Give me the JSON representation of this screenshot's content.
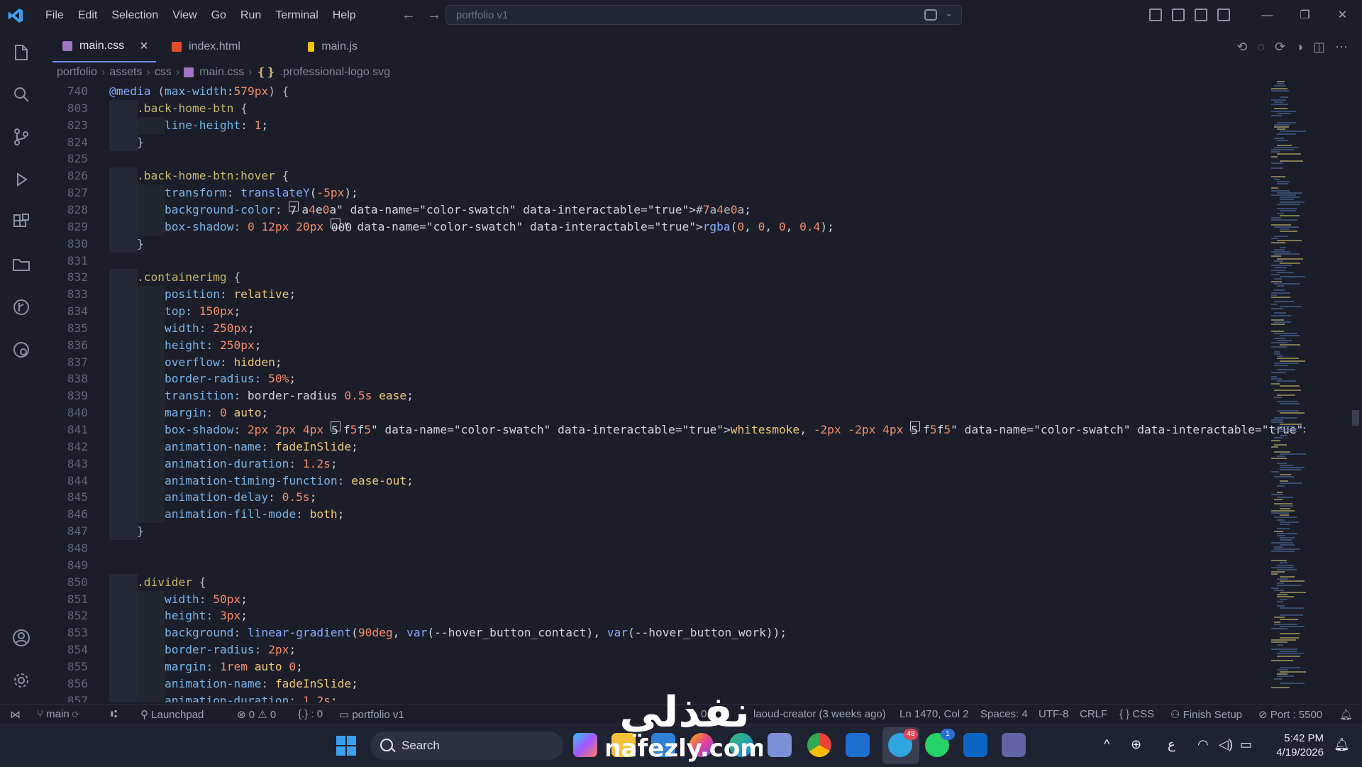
{
  "menu": [
    "File",
    "Edit",
    "Selection",
    "View",
    "Go",
    "Run",
    "Terminal",
    "Help"
  ],
  "search": {
    "placeholder": "portfolio v1"
  },
  "tabs": [
    {
      "label": "main.css",
      "color": "#a074c4"
    },
    {
      "label": "index.html",
      "color": "#e44d26"
    },
    {
      "label": "main.js",
      "color": "#f1c40f"
    }
  ],
  "breadcrumb": [
    "portfolio",
    "assets",
    "css",
    "main.css",
    ".professional-logo svg"
  ],
  "code_lines": [
    {
      "n": "740",
      "t": "@media (max-width:579px) {"
    },
    {
      "n": "803",
      "t": "    .back-home-btn {"
    },
    {
      "n": "823",
      "t": "        line-height: 1;"
    },
    {
      "n": "824",
      "t": "    }"
    },
    {
      "n": "825",
      "t": ""
    },
    {
      "n": "826",
      "t": "    .back-home-btn:hover {"
    },
    {
      "n": "827",
      "t": "        transform: translateY(-5px);"
    },
    {
      "n": "828",
      "t": "        background-color: #7a4e0a;"
    },
    {
      "n": "829",
      "t": "        box-shadow: 0 12px 20px rgba(0, 0, 0, 0.4);"
    },
    {
      "n": "830",
      "t": "    }"
    },
    {
      "n": "831",
      "t": ""
    },
    {
      "n": "832",
      "t": "    .containerimg {"
    },
    {
      "n": "833",
      "t": "        position: relative;"
    },
    {
      "n": "834",
      "t": "        top: 150px;"
    },
    {
      "n": "835",
      "t": "        width: 250px;"
    },
    {
      "n": "836",
      "t": "        height: 250px;"
    },
    {
      "n": "837",
      "t": "        overflow: hidden;"
    },
    {
      "n": "838",
      "t": "        border-radius: 50%;"
    },
    {
      "n": "839",
      "t": "        transition: border-radius 0.5s ease;"
    },
    {
      "n": "840",
      "t": "        margin: 0 auto;"
    },
    {
      "n": "841",
      "t": "        box-shadow: 2px 2px 4px whitesmoke, -2px -2px 4px whitesmoke;"
    },
    {
      "n": "842",
      "t": "        animation-name: fadeInSlide;"
    },
    {
      "n": "843",
      "t": "        animation-duration: 1.2s;"
    },
    {
      "n": "844",
      "t": "        animation-timing-function: ease-out;"
    },
    {
      "n": "845",
      "t": "        animation-delay: 0.5s;"
    },
    {
      "n": "846",
      "t": "        animation-fill-mode: both;"
    },
    {
      "n": "847",
      "t": "    }"
    },
    {
      "n": "848",
      "t": ""
    },
    {
      "n": "849",
      "t": ""
    },
    {
      "n": "850",
      "t": "    .divider {"
    },
    {
      "n": "851",
      "t": "        width: 50px;"
    },
    {
      "n": "852",
      "t": "        height: 3px;"
    },
    {
      "n": "853",
      "t": "        background: linear-gradient(90deg, var(--hover_button_contact), var(--hover_button_work));"
    },
    {
      "n": "854",
      "t": "        border-radius: 2px;"
    },
    {
      "n": "855",
      "t": "        margin: 1rem auto 0;"
    },
    {
      "n": "856",
      "t": "        animation-name: fadeInSlide;"
    },
    {
      "n": "857",
      "t": "        animation-duration: 1.2s;"
    }
  ],
  "status": {
    "branch": "main",
    "launchpad": "Launchpad",
    "errors": "0",
    "warnings": "0",
    "braces": "{.} : 0",
    "folder": "portfolio v1",
    "blame": "0",
    "author": "laoud-creator (3 weeks ago)",
    "position": "Ln 1470, Col 2",
    "spaces": "Spaces: 4",
    "encoding": "UTF-8",
    "eol": "CRLF",
    "language": "CSS",
    "finish": "Finish Setup",
    "port": "Port : 5500"
  },
  "taskbar": {
    "search_label": "Search",
    "telegram_badge": "48",
    "whatsapp_badge": "1",
    "ime": "ع",
    "time": "5:42 PM",
    "date": "4/19/2026"
  },
  "watermark": {
    "arabic": "نفذلي",
    "latin": "nafezly.com"
  }
}
